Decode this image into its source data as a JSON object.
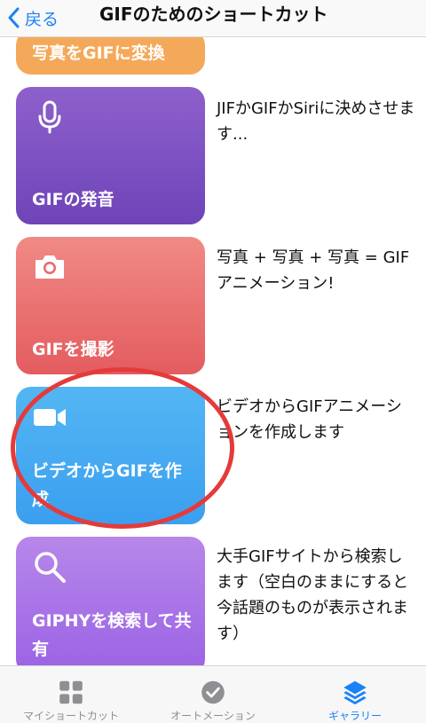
{
  "navbar": {
    "back_label": "戻る",
    "title": "GIFのためのショートカット"
  },
  "shortcuts": [
    {
      "title": "写真をGIFに変換",
      "color": "#f4a95a",
      "icon": "",
      "description": ""
    },
    {
      "title": "GIFの発音",
      "color": "#7b4fc2",
      "icon": "microphone-icon",
      "description": "JIFかGIFかSiriに決めさせます..."
    },
    {
      "title": "GIFを撮影",
      "color": "#e8696b",
      "icon": "camera-icon",
      "description": "写真 + 写真 + 写真 = GIFアニメーション!"
    },
    {
      "title": "ビデオからGIFを作成",
      "color": "#45a8f2",
      "icon": "video-camera-icon",
      "description": "ビデオからGIFアニメーションを作成します"
    },
    {
      "title": "GIPHYを検索して共有",
      "color": "#a771e7",
      "icon": "magnifier-icon",
      "description": "大手GIFサイトから検索します（空白のままにすると今話題のものが表示されます）"
    }
  ],
  "annotation": {
    "color": "#e53a3a",
    "target": "ビデオからGIFを作成"
  },
  "tabbar": {
    "tabs": [
      {
        "label": "マイショートカット",
        "icon": "grid-icon",
        "active": false
      },
      {
        "label": "オートメーション",
        "icon": "clock-icon",
        "active": false
      },
      {
        "label": "ギャラリー",
        "icon": "layers-icon",
        "active": true
      }
    ]
  },
  "colors": {
    "accent": "#1a82f7"
  }
}
